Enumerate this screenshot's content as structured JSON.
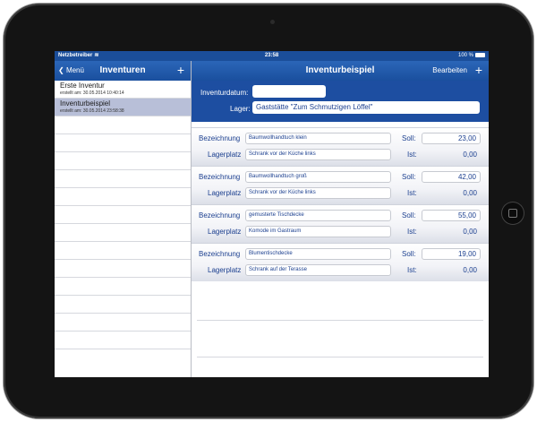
{
  "status": {
    "carrier": "Netzbetreiber",
    "time": "23:58",
    "battery": "100 %"
  },
  "master": {
    "back_label": "Menü",
    "title": "Inventuren",
    "add_label": "+",
    "items": [
      {
        "title": "Erste Inventur",
        "subtitle": "erstellt am: 30.05.2014 10:40:14",
        "selected": false
      },
      {
        "title": "Inventurbeispiel",
        "subtitle": "erstellt am: 30.05.2014 23:58:38",
        "selected": true
      }
    ]
  },
  "detail": {
    "title": "Inventurbeispiel",
    "edit_label": "Bearbeiten",
    "add_label": "+",
    "date_label": "Inventurdatum:",
    "date_value": "",
    "storage_label": "Lager:",
    "storage_value": "Gaststätte \"Zum Schmutzigen Löffel\"",
    "labels": {
      "name": "Bezeichnung",
      "place": "Lagerplatz",
      "target": "Soll:",
      "actual": "Ist:"
    },
    "items": [
      {
        "name": "Baumwollhandtuch klein",
        "place": "Schrank vor der Küche links",
        "target": "23,00",
        "actual": "0,00"
      },
      {
        "name": "Baumwollhandtuch groß",
        "place": "Schrank vor der Küche links",
        "target": "42,00",
        "actual": "0,00"
      },
      {
        "name": "gemusterte Tischdecke",
        "place": "Komode im Gastraum",
        "target": "55,00",
        "actual": "0,00"
      },
      {
        "name": "Blumentischdecke",
        "place": "Schrank auf der Terasse",
        "target": "19,00",
        "actual": "0,00"
      }
    ]
  }
}
